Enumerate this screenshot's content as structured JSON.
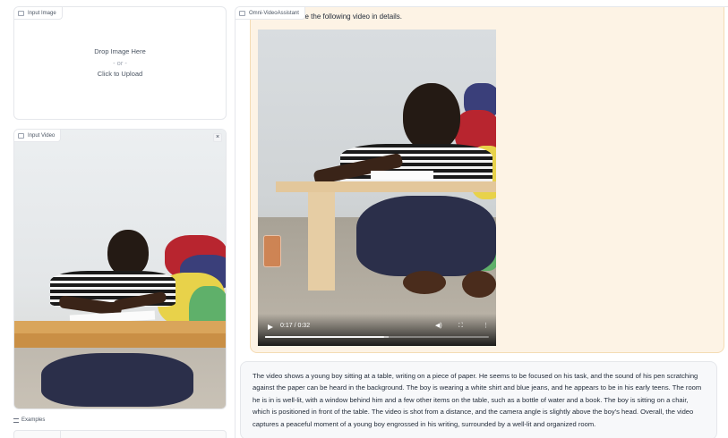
{
  "input_image": {
    "label": "Input Image",
    "drop_text": "Drop Image Here",
    "or_text": "- or -",
    "upload_text": "Click to Upload"
  },
  "input_video": {
    "label": "Input Video",
    "close_icon": "close-icon"
  },
  "examples": {
    "label": "Examples"
  },
  "chatbot": {
    "label": "Omni-VideoAssistant",
    "user_message": "Please describe the following video in details.",
    "video": {
      "time": "0:17 / 0:32",
      "progress": 0.53,
      "buffered": 0.55
    },
    "assistant_message": "The video shows a young boy sitting at a table, writing on a piece of paper. He seems to be focused on his task, and the sound of his pen scratching against the paper can be heard in the background. The boy is wearing a white shirt and blue jeans, and he appears to be in his early teens. The room he is in is well-lit, with a window behind him and a few other items on the table, such as a bottle of water and a book. The boy is sitting on a chair, which is positioned in front of the table. The video is shot from a distance, and the camera angle is slightly above the boy's head. Overall, the video captures a peaceful moment of a young boy engrossed in his writing, surrounded by a well-lit and organized room."
  },
  "colors": {
    "user_bubble": "#fdf3e5",
    "user_border": "#f4dcb4",
    "bot_bubble": "#f7f8fa",
    "border": "#e5e7eb"
  }
}
